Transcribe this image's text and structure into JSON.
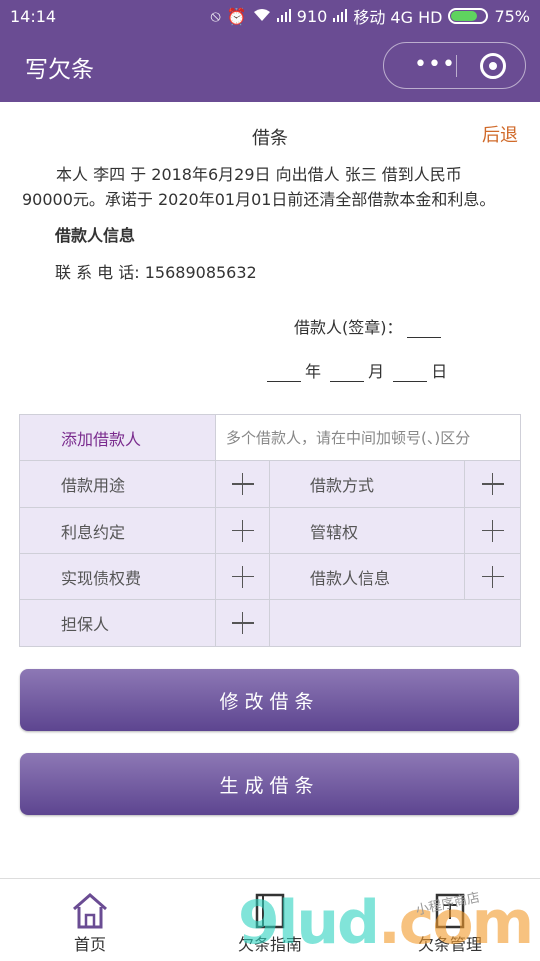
{
  "status_bar": {
    "time": "14:14",
    "signal_text": "910",
    "carrier": "移动 4G HD",
    "battery": "75%",
    "battery_level": 0.75
  },
  "nav": {
    "title": "写欠条",
    "capsule_dots": "•••"
  },
  "document": {
    "title": "借条",
    "back": "后退",
    "body": "本人 李四 于 2018年6月29日 向出借人 张三 借到人民币 90000元。承诺于 2020年01月01日前还清全部借款本金和利息。",
    "borrower_info_heading": "借款人信息",
    "phone_line": "联 系 电 话: 15689085632",
    "sign_label": "借款人(签章)：",
    "date_year": "年",
    "date_month": "月",
    "date_day": "日"
  },
  "form": {
    "add_borrower": "添加借款人",
    "borrower_placeholder": "多个借款人，请在中间加顿号(、)区分",
    "items": {
      "purpose": "借款用途",
      "method": "借款方式",
      "interest": "利息约定",
      "jurisdiction": "管辖权",
      "cost": "实现债权费",
      "borrower_info": "借款人信息",
      "guarantor": "担保人"
    }
  },
  "buttons": {
    "modify": "修改借条",
    "generate": "生成借条"
  },
  "tabbar": {
    "home": "首页",
    "guide": "欠条指南",
    "manage": "欠条管理"
  },
  "watermark": {
    "text": "9lud",
    "suffix": ".com",
    "script": "小程序商店"
  },
  "colors": {
    "brand": "#6a4c93",
    "accent_link": "#d06a2a",
    "grid_bg": "#ece7f6",
    "add_borrower": "#7a2c8e"
  }
}
